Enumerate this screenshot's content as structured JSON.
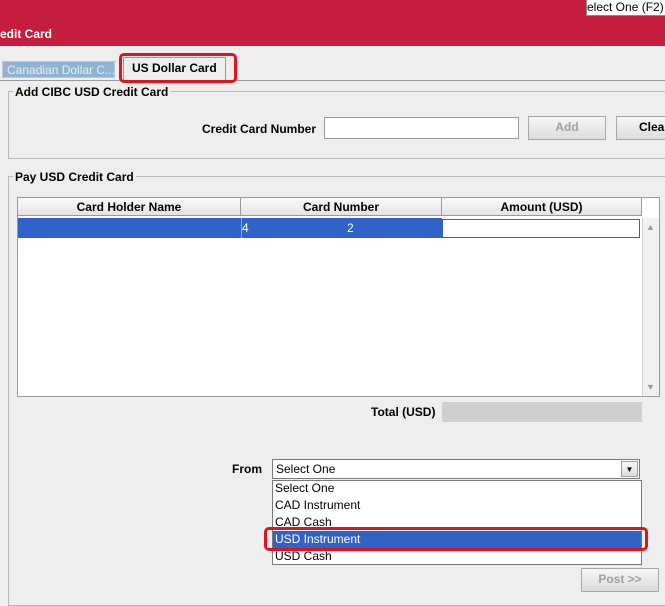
{
  "header": {
    "title": "edit Card",
    "top_select": "elect One (F2)"
  },
  "tabs": [
    {
      "label": "Canadian Dollar C...",
      "active": false
    },
    {
      "label": "US Dollar Card",
      "active": true
    }
  ],
  "add_section": {
    "title": "Add CIBC USD Credit Card",
    "card_number_label": "Credit Card Number",
    "card_number_value": "",
    "add_label": "Add",
    "clear_label": "Clear"
  },
  "pay_section": {
    "title": "Pay USD Credit Card",
    "columns": [
      "Card Holder Name",
      "Card Number",
      "Amount (USD)"
    ],
    "rows": [
      {
        "holder": "",
        "number_a": "4",
        "number_b": "2",
        "amount": ""
      }
    ],
    "total_label": "Total (USD)",
    "total_value": "",
    "from_label": "From",
    "from_selected": "Select One",
    "from_options": [
      "Select One",
      "CAD Instrument",
      "CAD Cash",
      "USD Instrument",
      "USD Cash"
    ],
    "highlighted_option": "USD Instrument",
    "post_label": "Post >>"
  },
  "icons": {
    "dropdown_arrow": "chevron-down-icon",
    "scroll_up": "triangle-up-icon",
    "scroll_down": "triangle-down-icon"
  },
  "colors": {
    "header": "#c41d3e",
    "selection": "#3162c8",
    "annotation": "#e0141e"
  }
}
